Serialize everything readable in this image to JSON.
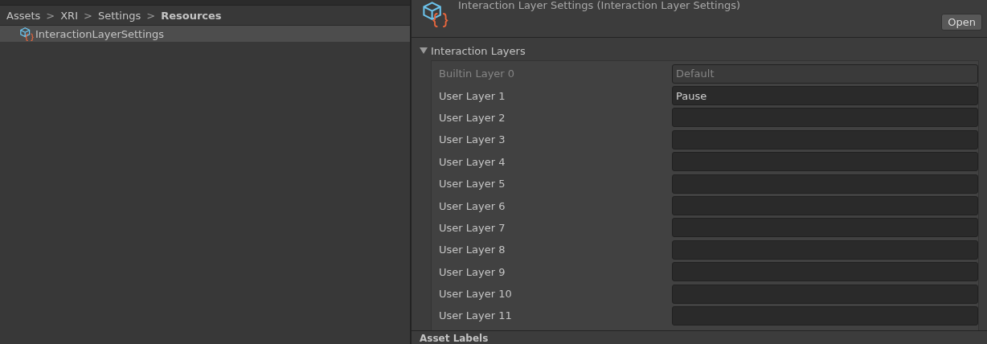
{
  "breadcrumb": [
    {
      "label": "Assets",
      "current": false
    },
    {
      "label": "XRI",
      "current": false
    },
    {
      "label": "Settings",
      "current": false
    },
    {
      "label": "Resources",
      "current": true
    }
  ],
  "separator": ">",
  "project_items": [
    {
      "label": "InteractionLayerSettings",
      "selected": true
    }
  ],
  "inspector": {
    "title": "Interaction Layer Settings (Interaction Layer Settings)",
    "open_button": "Open",
    "section": {
      "title": "Interaction Layers",
      "expanded": true,
      "rows": [
        {
          "label": "Builtin Layer 0",
          "value": "Default",
          "disabled": true
        },
        {
          "label": "User Layer 1",
          "value": "Pause",
          "disabled": false
        },
        {
          "label": "User Layer 2",
          "value": "",
          "disabled": false
        },
        {
          "label": "User Layer 3",
          "value": "",
          "disabled": false
        },
        {
          "label": "User Layer 4",
          "value": "",
          "disabled": false
        },
        {
          "label": "User Layer 5",
          "value": "",
          "disabled": false
        },
        {
          "label": "User Layer 6",
          "value": "",
          "disabled": false
        },
        {
          "label": "User Layer 7",
          "value": "",
          "disabled": false
        },
        {
          "label": "User Layer 8",
          "value": "",
          "disabled": false
        },
        {
          "label": "User Layer 9",
          "value": "",
          "disabled": false
        },
        {
          "label": "User Layer 10",
          "value": "",
          "disabled": false
        },
        {
          "label": "User Layer 11",
          "value": "",
          "disabled": false
        }
      ]
    },
    "footer": "Asset Labels"
  }
}
